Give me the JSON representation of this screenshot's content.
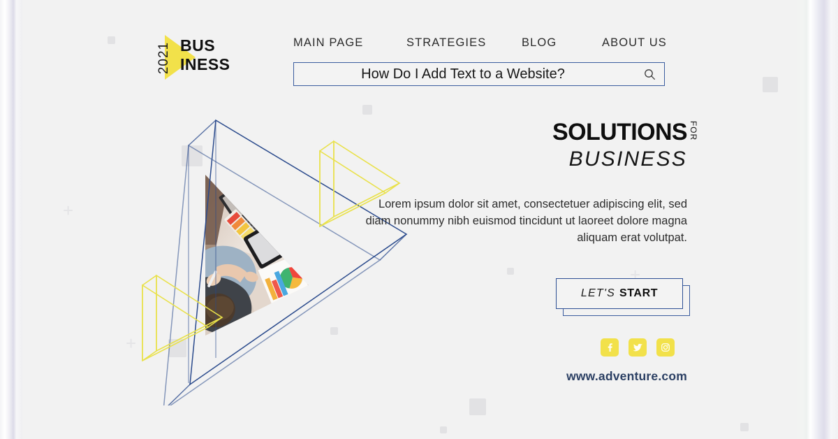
{
  "brand": {
    "year": "2021",
    "name_line1": "BUS",
    "name_line2": "INESS",
    "logo_color": "#f2e14a"
  },
  "nav": {
    "items": [
      {
        "label": "MAIN PAGE"
      },
      {
        "label": "STRATEGIES"
      },
      {
        "label": "BLOG"
      },
      {
        "label": "ABOUT US"
      }
    ]
  },
  "search": {
    "value": "How Do I Add Text to a Website?",
    "placeholder": "Search",
    "icon": "search-icon",
    "border_color": "#3a5c9e"
  },
  "hero": {
    "headline_main": "SOLUTIONS",
    "headline_for": "FOR",
    "headline_sub": "BUSINESS",
    "body": "Lorem ipsum dolor sit amet, consectetuer adipiscing elit, sed diam nonummy nibh euismod tincidunt ut laoreet dolore magna aliquam erat volutpat.",
    "cta_prefix": "LET'S",
    "cta_emphasis": "START",
    "url": "www.adventure.com"
  },
  "socials": [
    {
      "name": "facebook-icon",
      "glyph": "f"
    },
    {
      "name": "twitter-icon",
      "glyph": "t"
    },
    {
      "name": "instagram-icon",
      "glyph": "i"
    }
  ],
  "theme": {
    "background": "#f2f2f2",
    "accent_blue": "#2d4f94",
    "accent_yellow": "#f2e14a",
    "text_dark": "#141414",
    "url_color": "#2b3f63"
  }
}
